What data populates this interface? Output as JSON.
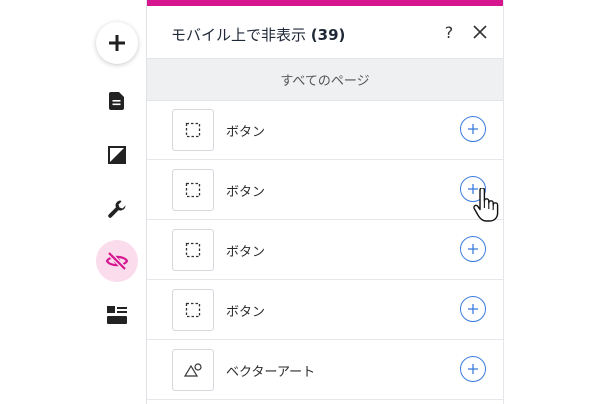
{
  "panel": {
    "title": "モバイル上で非表示",
    "count": "(39)",
    "help_label": "?",
    "filter_label": "すべてのページ"
  },
  "sidebar": {
    "items": [
      {
        "icon": "plus-icon"
      },
      {
        "icon": "page-icon"
      },
      {
        "icon": "theme-icon"
      },
      {
        "icon": "wrench-icon"
      },
      {
        "icon": "hidden-eye-icon",
        "active": true
      },
      {
        "icon": "layout-icon"
      }
    ]
  },
  "items": [
    {
      "label": "ボタン",
      "thumb_icon": "dashed-box-icon"
    },
    {
      "label": "ボタン",
      "thumb_icon": "dashed-box-icon"
    },
    {
      "label": "ボタン",
      "thumb_icon": "dashed-box-icon"
    },
    {
      "label": "ボタン",
      "thumb_icon": "dashed-box-icon"
    },
    {
      "label": "ベクターアート",
      "thumb_icon": "shapes-icon"
    }
  ],
  "colors": {
    "accent": "#d6168f",
    "active_bg": "#fadcec",
    "link_blue": "#3b7ddd"
  }
}
